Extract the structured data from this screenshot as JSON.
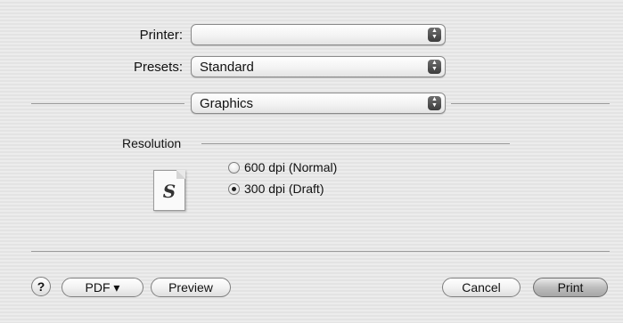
{
  "printer": {
    "label": "Printer:",
    "value": ""
  },
  "presets": {
    "label": "Presets:",
    "value": "Standard"
  },
  "panel": {
    "value": "Graphics"
  },
  "resolution": {
    "title": "Resolution",
    "icon_glyph": "S",
    "options": [
      {
        "label": "600 dpi (Normal)",
        "selected": false
      },
      {
        "label": "300 dpi (Draft)",
        "selected": true
      }
    ]
  },
  "footer": {
    "help": "?",
    "pdf": "PDF ▾",
    "preview": "Preview",
    "cancel": "Cancel",
    "print": "Print"
  },
  "icons": {
    "popup_arrows": "updown-arrows-icon",
    "help": "question-mark-icon",
    "document": "document-icon"
  }
}
